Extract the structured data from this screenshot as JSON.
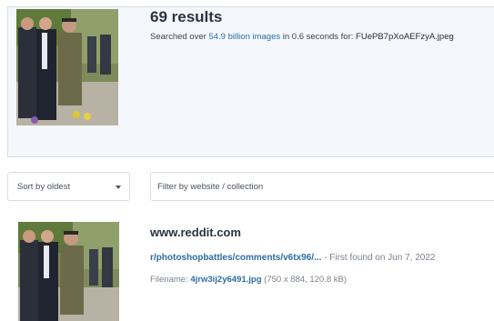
{
  "summary": {
    "results_title": "69 results",
    "searched_prefix": "Searched over ",
    "images_count": "54.9 billion images",
    "searched_mid": " in 0.6 seconds for: ",
    "query_filename": "FUePB7pXoAEFzyA.jpeg"
  },
  "filters": {
    "sort_label": "Sort by oldest",
    "filter_placeholder": "Filter by website / collection"
  },
  "result": {
    "domain": "www.reddit.com",
    "link": "r/photoshopbattles/comments/v6tx96/...",
    "first_found": " - First found on Jun 7, 2022",
    "filename_label": "Filename: ",
    "filename": "4jrw3ij2y6491.jpg",
    "file_meta": " (750 x 884, 120.8 kB)"
  }
}
